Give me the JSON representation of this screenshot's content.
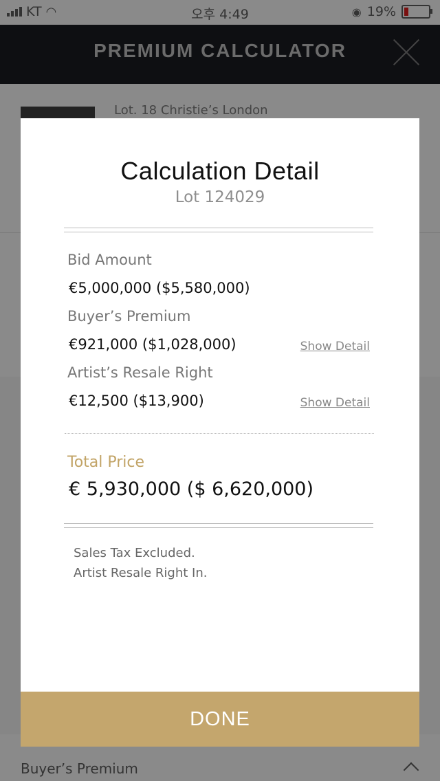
{
  "status_bar": {
    "carrier": "KT",
    "time": "오후 4:49",
    "battery_percent": "19%",
    "battery_level": 0.19
  },
  "header": {
    "title": "PREMIUM CALCULATOR",
    "close_icon": "close-icon"
  },
  "background": {
    "lot_title": "Lot. 18 Christie’s London",
    "section_label": "Buyer’s Premium"
  },
  "modal": {
    "title": "Calculation Detail",
    "subtitle": "Lot 124029",
    "rows": [
      {
        "label": "Bid Amount",
        "eur": "€5,000,000",
        "usd": "($5,580,000)",
        "link": ""
      },
      {
        "label": "Buyer’s Premium",
        "eur": "€921,000",
        "usd": "($1,028,000)",
        "link": "Show Detail"
      },
      {
        "label": "Artist’s Resale Right",
        "eur": "€12,500",
        "usd": "($13,900)",
        "link": "Show Detail"
      }
    ],
    "total": {
      "label": "Total Price",
      "eur": "€ 5,930,000",
      "usd": "($ 6,620,000)"
    },
    "notes": [
      "Sales Tax Excluded.",
      "Artist Resale Right In."
    ],
    "done_label": "DONE"
  },
  "colors": {
    "accent_gold": "#c4a66d",
    "header_bg": "#0e0f12",
    "overlay": "#8a8a8a"
  }
}
